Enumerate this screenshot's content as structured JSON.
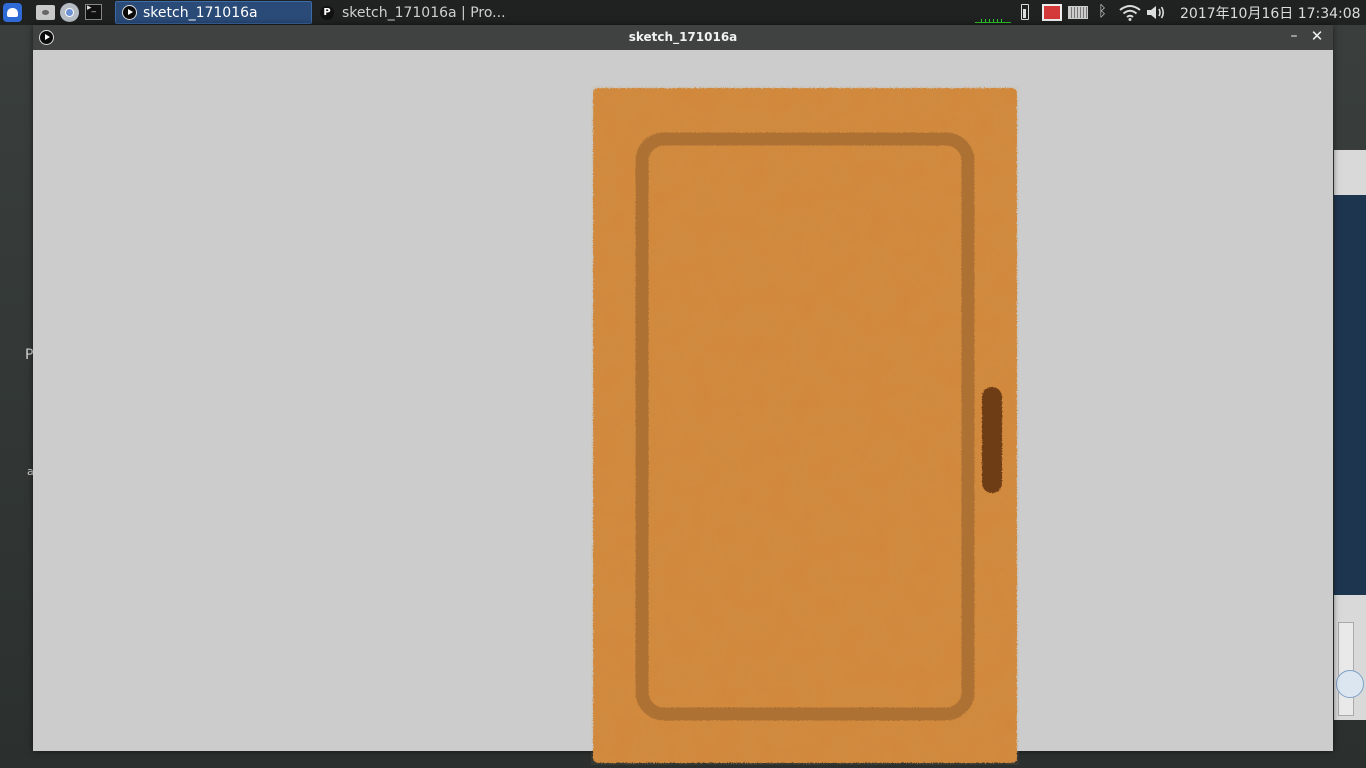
{
  "taskbar": {
    "tasks": [
      {
        "label": "sketch_171016a",
        "active": true,
        "icon": "play-icon"
      },
      {
        "label": "sketch_171016a | Pro...",
        "active": false,
        "icon": "processing-icon"
      }
    ],
    "launchers": [
      "app-menu-icon",
      "file-manager-icon",
      "browser-icon",
      "terminal-icon"
    ],
    "tray_icons": [
      "cpu-graph",
      "battery-icon",
      "record-icon",
      "keyboard-icon",
      "bluetooth-icon",
      "wifi-icon",
      "volume-icon"
    ],
    "clock": "2017年10月16日 17:34:08"
  },
  "window": {
    "title": "sketch_171016a",
    "controls": {
      "minimize": "–",
      "close": "✕"
    }
  },
  "sketch": {
    "background_color": "#cccccc",
    "door": {
      "color": "#d2883a",
      "panel_outline_color": "#a86d33",
      "handle_color": "#6e3d12"
    }
  },
  "background_app": {
    "letters": [
      "P",
      "a"
    ]
  }
}
